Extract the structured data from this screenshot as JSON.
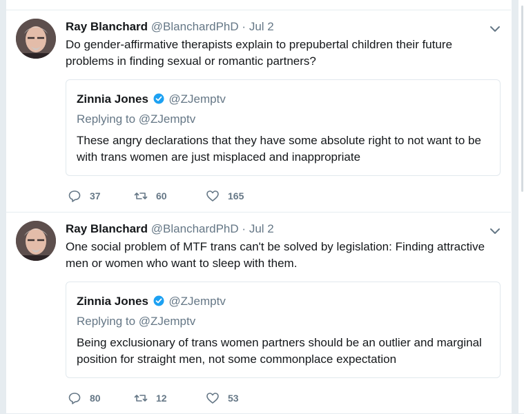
{
  "tweets": [
    {
      "author_name": "Ray Blanchard",
      "author_handle": "@BlanchardPhD",
      "separator": "·",
      "date": "Jul 2",
      "text": "Do gender-affirmative therapists explain to prepubertal children their future problems in finding sexual or romantic partners?",
      "quoted": {
        "name": "Zinnia Jones",
        "handle": "@ZJemptv",
        "replying_to": "Replying to @ZJemptv",
        "text": "These angry declarations that they have some absolute right to not want to be with trans women are just misplaced and inappropriate"
      },
      "replies": "37",
      "retweets": "60",
      "likes": "165"
    },
    {
      "author_name": "Ray Blanchard",
      "author_handle": "@BlanchardPhD",
      "separator": "·",
      "date": "Jul 2",
      "text": "One social problem of MTF trans can't be solved by legislation: Finding attractive men or women who want to sleep with them.",
      "quoted": {
        "name": "Zinnia Jones",
        "handle": "@ZJemptv",
        "replying_to": "Replying to @ZJemptv",
        "text": "Being exclusionary of trans women partners should be an outlier and marginal position for straight men, not some commonplace expectation"
      },
      "replies": "80",
      "retweets": "12",
      "likes": "53"
    }
  ],
  "icons": {
    "reply": "reply-icon",
    "retweet": "retweet-icon",
    "like": "heart-icon",
    "verified": "verified-badge-icon",
    "more": "chevron-down-icon"
  },
  "colors": {
    "text": "#14171a",
    "muted": "#657786",
    "border": "#e1e8ed",
    "verified": "#1da1f2",
    "background": "#e6ecf0"
  }
}
